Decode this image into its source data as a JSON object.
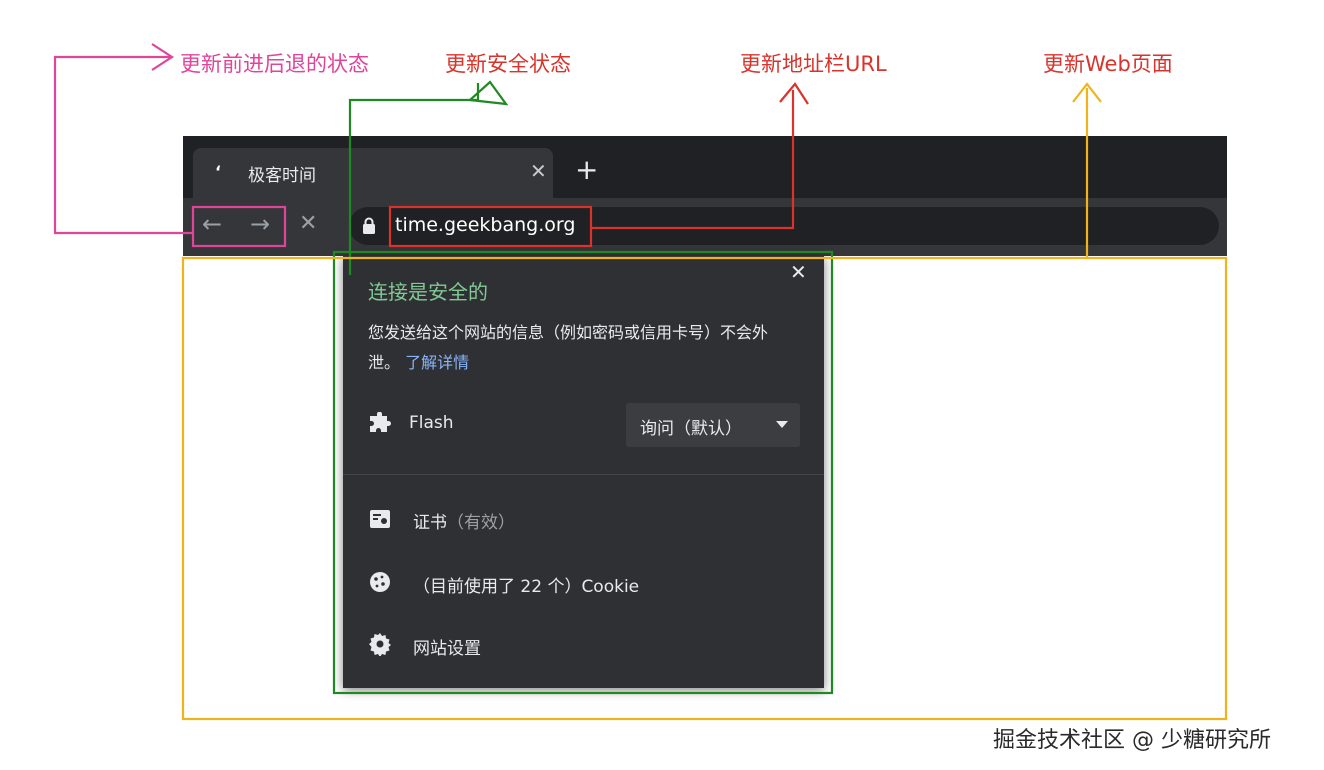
{
  "annotations": {
    "nav_state": "更新前进后退的状态",
    "security_state": "更新安全状态",
    "url_bar": "更新地址栏URL",
    "web_page": "更新Web页面"
  },
  "tab": {
    "title": "极客时间",
    "close_glyph": "✕",
    "new_tab_glyph": "+"
  },
  "toolbar": {
    "back_glyph": "←",
    "forward_glyph": "→",
    "stop_glyph": "✕",
    "url": "time.geekbang.org"
  },
  "popup": {
    "close_glyph": "✕",
    "title": "连接是安全的",
    "description": "您发送给这个网站的信息（例如密码或信用卡号）不会外泄。",
    "learn_more": "了解详情",
    "flash_label": "Flash",
    "flash_select_value": "询问（默认）",
    "certificate_label": "证书",
    "certificate_status": "（有效）",
    "cookie_label": "（目前使用了 22 个）Cookie",
    "site_settings_label": "网站设置"
  },
  "colors": {
    "pink": "#e0459a",
    "green": "#1f8a24",
    "red": "#d9332b",
    "yellow": "#f2b21b",
    "secure_green": "#81c995",
    "link_blue": "#8ab4f8"
  },
  "watermark": "掘金技术社区 @ 少糖研究所"
}
